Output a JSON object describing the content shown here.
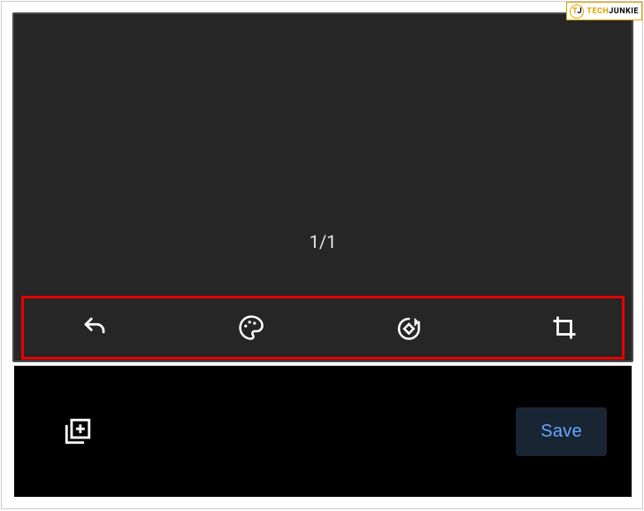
{
  "watermark": {
    "logo_t": "T",
    "logo_j": "J",
    "text_tech": "TECH",
    "text_junkie": "JUNKIE"
  },
  "counter": {
    "label": "1/1"
  },
  "toolbar": {
    "undo_name": "undo-icon",
    "palette_name": "palette-icon",
    "rotate_name": "rotate-icon",
    "crop_name": "crop-icon"
  },
  "bottom": {
    "add_name": "add-to-library-icon",
    "save_label": "Save"
  }
}
